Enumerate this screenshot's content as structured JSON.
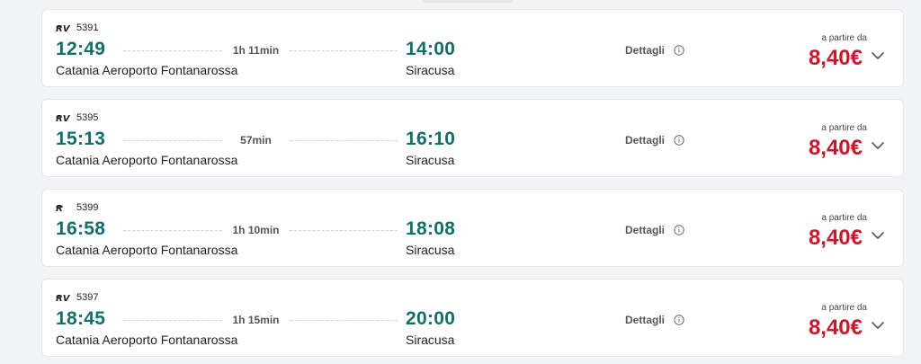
{
  "results": [
    {
      "train_type_icon": "rv-regionale-veloce-icon",
      "train_number": "5391",
      "departure_time": "12:49",
      "duration": "1h 11min",
      "arrival_time": "14:00",
      "departure_station": "Catania Aeroporto Fontanarossa",
      "arrival_station": "Siracusa",
      "details_label": "Dettagli",
      "from_label": "a partire da",
      "price": "8,40€"
    },
    {
      "train_type_icon": "rv-regionale-veloce-icon",
      "train_number": "5395",
      "departure_time": "15:13",
      "duration": "57min",
      "arrival_time": "16:10",
      "departure_station": "Catania Aeroporto Fontanarossa",
      "arrival_station": "Siracusa",
      "details_label": "Dettagli",
      "from_label": "a partire da",
      "price": "8,40€"
    },
    {
      "train_type_icon": "r-regionale-icon",
      "train_number": "5399",
      "departure_time": "16:58",
      "duration": "1h 10min",
      "arrival_time": "18:08",
      "departure_station": "Catania Aeroporto Fontanarossa",
      "arrival_station": "Siracusa",
      "details_label": "Dettagli",
      "from_label": "a partire da",
      "price": "8,40€"
    },
    {
      "train_type_icon": "rv-regionale-veloce-icon",
      "train_number": "5397",
      "departure_time": "18:45",
      "duration": "1h 15min",
      "arrival_time": "20:00",
      "departure_station": "Catania Aeroporto Fontanarossa",
      "arrival_station": "Siracusa",
      "details_label": "Dettagli",
      "from_label": "a partire da",
      "price": "8,40€"
    }
  ],
  "colors": {
    "time": "#11706a",
    "price": "#d2142a",
    "background": "#f3f4f6"
  }
}
